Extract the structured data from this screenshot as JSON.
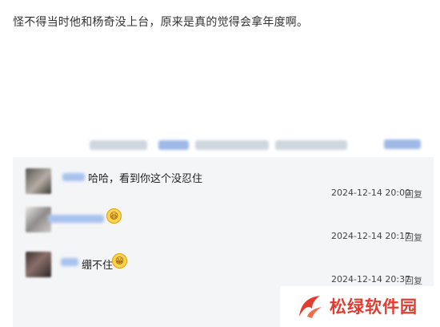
{
  "post": {
    "text": "怪不得当时他和杨奇没上台，原来是真的觉得会拿年度啊。"
  },
  "comments": [
    {
      "text": "哈哈，看到你这个没忍住",
      "emoji": "",
      "timestamp": "2024-12-14 20:00",
      "reply_label": "回复"
    },
    {
      "text": "",
      "emoji": "laughing-emoji",
      "timestamp": "2024-12-14 20:17",
      "reply_label": "回复"
    },
    {
      "text": "绷不住",
      "emoji": "grinning-emoji",
      "timestamp": "2024-12-14 20:37",
      "reply_label": "回复"
    }
  ],
  "watermark": {
    "text": "松绿软件园",
    "color": "#e23b2f"
  }
}
